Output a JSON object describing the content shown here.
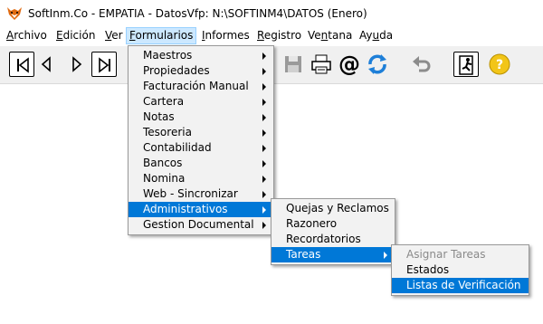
{
  "window": {
    "title": "SoftInm.Co - EMPATIA - DatosVfp: N:\\SOFTINM4\\DATOS  (Enero)",
    "icon": "fox-logo-icon"
  },
  "menubar": {
    "items": [
      {
        "label": "Archivo"
      },
      {
        "label": "Edición"
      },
      {
        "label": "Ver"
      },
      {
        "label": "Formularios"
      },
      {
        "label": "Informes"
      },
      {
        "label": "Registro"
      },
      {
        "label": "Ventana"
      },
      {
        "label": "Ayuda"
      }
    ]
  },
  "toolbar": {
    "buttons": [
      {
        "name": "first-record-icon"
      },
      {
        "name": "previous-record-icon"
      },
      {
        "name": "next-record-icon"
      },
      {
        "name": "last-record-icon"
      },
      {
        "name": "save-icon"
      },
      {
        "name": "print-icon"
      },
      {
        "name": "email-icon"
      },
      {
        "name": "refresh-icon"
      },
      {
        "name": "undo-icon"
      },
      {
        "name": "exit-icon"
      },
      {
        "name": "help-icon"
      }
    ]
  },
  "formularios_menu": {
    "items": [
      {
        "label": "Maestros"
      },
      {
        "label": "Propiedades"
      },
      {
        "label": "Facturación Manual"
      },
      {
        "label": "Cartera"
      },
      {
        "label": "Notas"
      },
      {
        "label": "Tesoreria"
      },
      {
        "label": "Contabilidad"
      },
      {
        "label": "Bancos"
      },
      {
        "label": "Nomina"
      },
      {
        "label": "Web - Sincronizar"
      },
      {
        "label": "Administrativos"
      },
      {
        "label": "Gestion Documental"
      }
    ]
  },
  "administrativos_menu": {
    "items": [
      {
        "label": "Quejas y Reclamos"
      },
      {
        "label": "Razonero"
      },
      {
        "label": "Recordatorios"
      },
      {
        "label": "Tareas"
      }
    ]
  },
  "tareas_menu": {
    "items": [
      {
        "label": "Asignar Tareas"
      },
      {
        "label": "Estados"
      },
      {
        "label": "Listas de Verificación"
      }
    ]
  },
  "colors": {
    "highlight": "#0078d7",
    "menu_active_bg": "#cce8ff",
    "menu_bg": "#f2f2f2",
    "disabled_text": "#8a8a8a"
  }
}
